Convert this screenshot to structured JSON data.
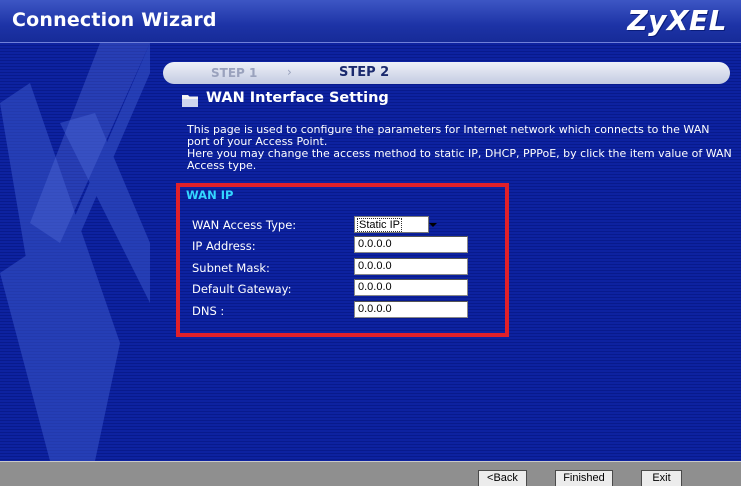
{
  "window": {
    "title": "Connection Wizard",
    "logo": "ZyXEL"
  },
  "steps": {
    "step1": "STEP 1",
    "separator": "›",
    "step2": "STEP 2",
    "active": "STEP 2"
  },
  "section": {
    "icon": "folder-icon",
    "title": "WAN Interface Setting",
    "description_line1": "This page is used to configure the parameters for Internet network which connects to the WAN port of your Access Point.",
    "description_line2": "Here you may change the access method to static IP, DHCP, PPPoE, by click the item value of WAN Access type."
  },
  "wan_ip": {
    "heading": "WAN IP",
    "access_type_label": "WAN Access Type:",
    "access_type_value": "Static IP",
    "fields": [
      {
        "label": "IP Address:",
        "value": "0.0.0.0"
      },
      {
        "label": "Subnet Mask:",
        "value": "0.0.0.0"
      },
      {
        "label": "Default Gateway:",
        "value": "0.0.0.0"
      },
      {
        "label": "DNS :",
        "value": "0.0.0.0"
      }
    ]
  },
  "buttons": {
    "back": "<Back",
    "finished": "Finished",
    "exit": "Exit"
  },
  "colors": {
    "highlight_box": "#e0202a",
    "section_heading": "#33d6ff",
    "background": "#0a1f94"
  }
}
